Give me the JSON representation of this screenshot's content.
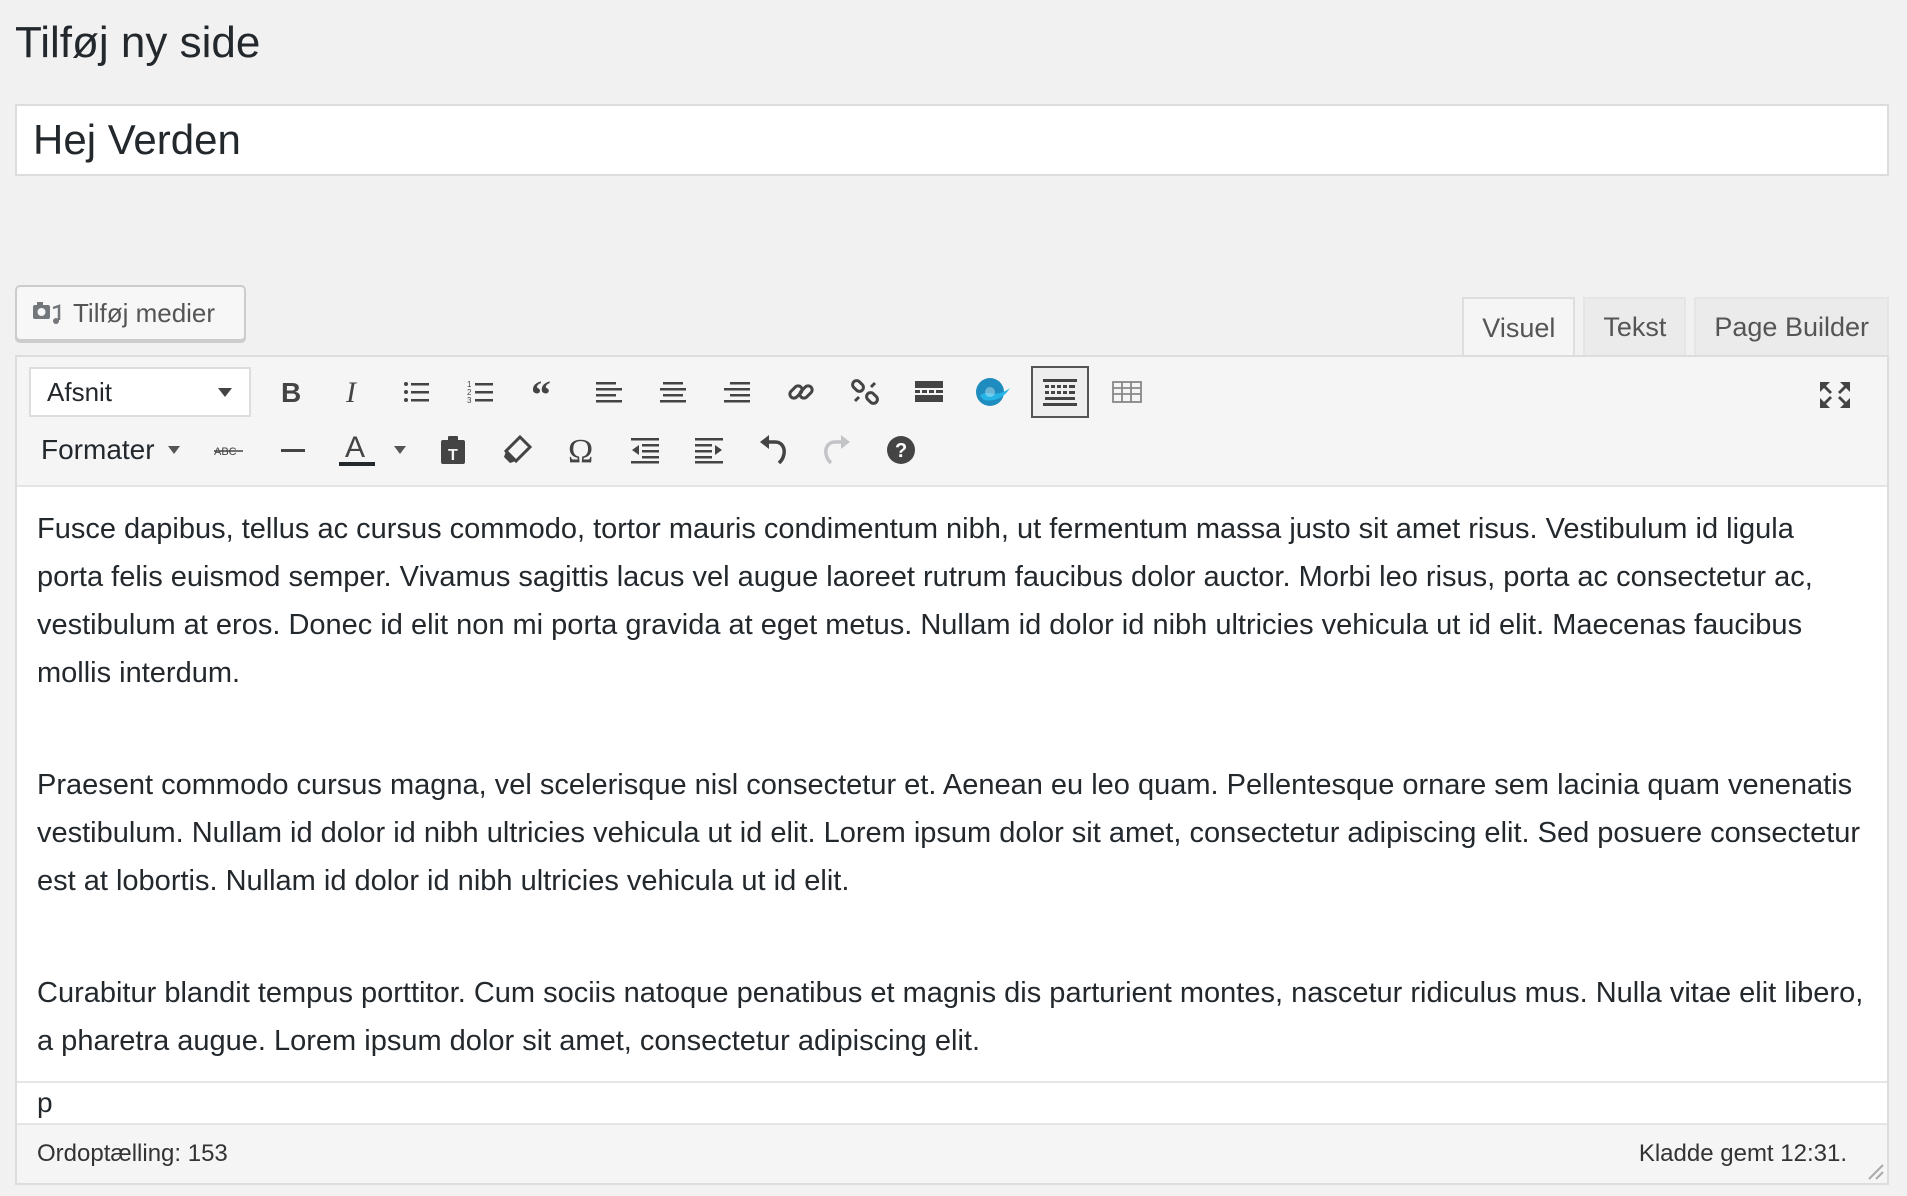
{
  "page": {
    "title": "Tilføj ny side"
  },
  "post_title": {
    "value": "Hej Verden"
  },
  "media_button": {
    "label": "Tilføj medier",
    "icon": "camera-music-icon"
  },
  "tabs": [
    {
      "label": "Visuel",
      "active": true
    },
    {
      "label": "Tekst",
      "active": false
    },
    {
      "label": "Page Builder",
      "active": false
    }
  ],
  "toolbar": {
    "block_format": "Afsnit",
    "format_menu": "Formater",
    "row1_icons": [
      "bold-icon",
      "italic-icon",
      "bullet-list-icon",
      "numbered-list-icon",
      "blockquote-icon",
      "align-left-icon",
      "align-center-icon",
      "align-right-icon",
      "link-icon",
      "unlink-icon",
      "read-more-icon",
      "plugin-wave-icon",
      "toolbar-toggle-icon",
      "table-icon"
    ],
    "row2_icons": [
      "strikethrough-icon",
      "horizontal-line-icon",
      "text-color-icon",
      "paste-as-text-icon",
      "clear-formatting-icon",
      "special-character-icon",
      "outdent-icon",
      "indent-icon",
      "undo-icon",
      "redo-icon",
      "help-icon"
    ],
    "fullscreen_icon": "fullscreen-icon"
  },
  "content": {
    "paragraphs": [
      "Fusce dapibus, tellus ac cursus commodo, tortor mauris condimentum nibh, ut fermentum massa justo sit amet risus. Vestibulum id ligula porta felis euismod semper. Vivamus sagittis lacus vel augue laoreet rutrum faucibus dolor auctor. Morbi leo risus, porta ac consectetur ac, vestibulum at eros. Donec id elit non mi porta gravida at eget metus. Nullam id dolor id nibh ultricies vehicula ut id elit. Maecenas faucibus mollis interdum.",
      "Praesent commodo cursus magna, vel scelerisque nisl consectetur et. Aenean eu leo quam. Pellentesque ornare sem lacinia quam venenatis vestibulum. Nullam id dolor id nibh ultricies vehicula ut id elit. Lorem ipsum dolor sit amet, consectetur adipiscing elit. Sed posuere consectetur est at lobortis. Nullam id dolor id nibh ultricies vehicula ut id elit.",
      "Curabitur blandit tempus porttitor. Cum sociis natoque penatibus et magnis dis parturient montes, nascetur ridiculus mus. Nulla vitae elit libero, a pharetra augue. Lorem ipsum dolor sit amet, consectetur adipiscing elit."
    ]
  },
  "path": "p",
  "status": {
    "word_count": "Ordoptælling: 153",
    "draft_saved": "Kladde gemt 12:31."
  },
  "colors": {
    "background": "#f1f1f1",
    "text": "#23282d",
    "border": "#dddddd",
    "wave_plugin": "#1e8cbe"
  }
}
